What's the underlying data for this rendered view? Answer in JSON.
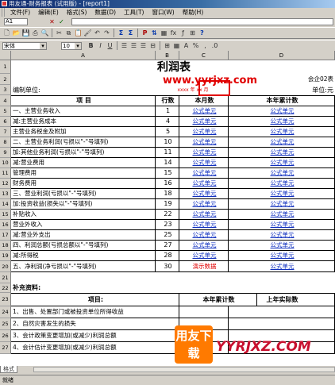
{
  "window": {
    "title": "用友通-财务报表 (试用版) - [report1]"
  },
  "menu": [
    "文件(F)",
    "编辑(E)",
    "格式(S)",
    "数据(D)",
    "工具(T)",
    "窗口(W)",
    "帮助(H)"
  ],
  "formula_bar": {
    "cell_ref": "A1",
    "cancel": "✕",
    "confirm": "✓"
  },
  "format_bar": {
    "font_name": "宋体",
    "font_size": "10"
  },
  "columns": [
    "A",
    "B",
    "C",
    "D"
  ],
  "sheet": {
    "title": "利润表",
    "form_no": "会企02表",
    "unit_label": "编制单位:",
    "currency_label": "单位:元",
    "date_placeholder": "xxxx 年    xx 月",
    "header": [
      "项       目",
      "行数",
      "本月数",
      "本年累计数"
    ],
    "rows": [
      {
        "item": "一、主营业务收入",
        "line": "1",
        "month": "公式单元",
        "year": "公式单元"
      },
      {
        "item": "  减:主营业务成本",
        "line": "4",
        "month": "公式单元",
        "year": "公式单元"
      },
      {
        "item": "      主营业务税金及附加",
        "line": "5",
        "month": "公式单元",
        "year": "公式单元"
      },
      {
        "item": "二、主营业务利润(亏损以\"-\"号填列)",
        "line": "10",
        "month": "公式单元",
        "year": "公式单元"
      },
      {
        "item": "  加:其他业务利润(亏损以\"-\"号填列)",
        "line": "11",
        "month": "公式单元",
        "year": "公式单元"
      },
      {
        "item": "  减:营业费用",
        "line": "14",
        "month": "公式单元",
        "year": "公式单元"
      },
      {
        "item": "      管理费用",
        "line": "15",
        "month": "公式单元",
        "year": "公式单元"
      },
      {
        "item": "      财务费用",
        "line": "16",
        "month": "公式单元",
        "year": "公式单元"
      },
      {
        "item": "三、营业利润(亏损以\"-\"号填列)",
        "line": "18",
        "month": "公式单元",
        "year": "公式单元"
      },
      {
        "item": "  加:投资收益(损失以\"-\"号填列)",
        "line": "19",
        "month": "公式单元",
        "year": "公式单元"
      },
      {
        "item": "      补贴收入",
        "line": "22",
        "month": "公式单元",
        "year": "公式单元"
      },
      {
        "item": "      营业外收入",
        "line": "23",
        "month": "公式单元",
        "year": "公式单元"
      },
      {
        "item": "  减:营业外支出",
        "line": "25",
        "month": "公式单元",
        "year": "公式单元"
      },
      {
        "item": "四、利润总额(亏损总额以\"-\"号填列)",
        "line": "27",
        "month": "公式单元",
        "year": "公式单元"
      },
      {
        "item": "  减:所得税",
        "line": "28",
        "month": "公式单元",
        "year": "公式单元"
      },
      {
        "item": "五、净利润(净亏损以\"-\"号填列)",
        "line": "30",
        "month": "演示数据",
        "year": "公式单元"
      }
    ],
    "supplement_label": "补充资料:",
    "supp_header": [
      "项目:",
      "本年累计数",
      "上年实际数"
    ],
    "supp_rows": [
      "1、出售、处置部门或被投资单位所得收益",
      "2、自然灾害发生的损失",
      "3、会计政策变更增加(或减少)利润总额",
      "4、会计估计变更增加(或减少)利润总额"
    ]
  },
  "row_numbers": [
    "1",
    "2",
    "3",
    "4",
    "5",
    "6",
    "7",
    "8",
    "9",
    "10",
    "11",
    "12",
    "13",
    "14",
    "15",
    "16",
    "17",
    "18",
    "19",
    "20",
    "21",
    "22",
    "23",
    "24",
    "25",
    "26",
    "27"
  ],
  "watermark": {
    "url": "www.yyrjxz.com",
    "logo": "用友下载",
    "brand": "YYRJXZ.COM"
  },
  "sheet_tab": "格式",
  "status": "就绪"
}
